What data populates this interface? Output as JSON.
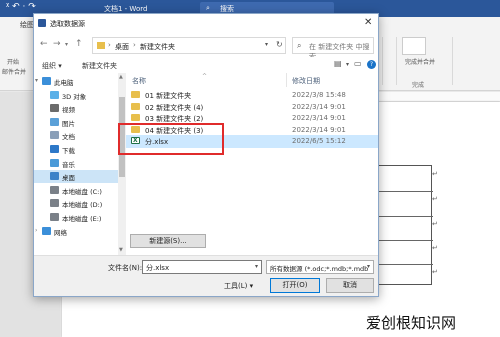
{
  "word": {
    "quick_access": "ᵡ ↶ · ↷",
    "doc_title": "文档1 - Word",
    "search_placeholder": "搜索",
    "tabs": [
      "绘图"
    ],
    "ribbon_left_labels": [
      "开始",
      "邮件合并"
    ],
    "ribbon_right_button": "完成并合并",
    "ribbon_right_group": "完成"
  },
  "dialog": {
    "title": "选取数据源",
    "address": {
      "crumbs": [
        "桌面",
        "新建文件夹"
      ]
    },
    "search_placeholder": "在 新建文件夹 中搜索",
    "toolbar": {
      "organize": "组织 ▾",
      "new_folder": "新建文件夹"
    },
    "sidebar": [
      {
        "label": "此电脑",
        "icon": "pc-icon",
        "color": "#3b8fd9"
      },
      {
        "label": "3D 对象",
        "icon": "3d-objects-icon",
        "color": "#5ab0e8"
      },
      {
        "label": "视频",
        "icon": "video-icon",
        "color": "#6b6b6b"
      },
      {
        "label": "图片",
        "icon": "pictures-icon",
        "color": "#5aa0d8"
      },
      {
        "label": "文档",
        "icon": "documents-icon",
        "color": "#8a9fb8"
      },
      {
        "label": "下载",
        "icon": "download-icon",
        "color": "#2d78c8"
      },
      {
        "label": "音乐",
        "icon": "music-icon",
        "color": "#4a9ad8"
      },
      {
        "label": "桌面",
        "icon": "desktop-icon",
        "color": "#3c82c8"
      },
      {
        "label": "本地磁盘 (C:)",
        "icon": "drive-icon",
        "color": "#7a8088"
      },
      {
        "label": "本地磁盘 (D:)",
        "icon": "drive-icon",
        "color": "#7a8088"
      },
      {
        "label": "本地磁盘 (E:)",
        "icon": "drive-icon",
        "color": "#7a8088"
      },
      {
        "label": "网络",
        "icon": "network-icon",
        "color": "#3b8fd9"
      }
    ],
    "columns": {
      "name": "名称",
      "modified": "修改日期"
    },
    "files": [
      {
        "name": "01 新建文件夹",
        "date": "2022/3/8 15:48",
        "type": "folder"
      },
      {
        "name": "02 新建文件夹 (4)",
        "date": "2022/3/14 9:01",
        "type": "folder"
      },
      {
        "name": "03 新建文件夹 (2)",
        "date": "2022/3/14 9:01",
        "type": "folder"
      },
      {
        "name": "04 新建文件夹 (3)",
        "date": "2022/3/14 9:01",
        "type": "folder"
      },
      {
        "name": "分.xlsx",
        "date": "2022/6/5 15:12",
        "type": "xlsx",
        "selected": true
      }
    ],
    "new_source_button": "新建源(S)...",
    "filename_label": "文件名(N):",
    "filename_value": "分.xlsx",
    "filter_value": "所有数据源 (*.odc;*.mdb;*.mdb",
    "tools_label": "工具(L) ▾",
    "open_button": "打开(O)",
    "cancel_button": "取消"
  },
  "colors": {
    "word_blue": "#2b579a",
    "selection": "#cce8ff",
    "highlight": "#e02b2b",
    "folder": "#e8bf4c"
  },
  "watermark": "爱创根知识网"
}
